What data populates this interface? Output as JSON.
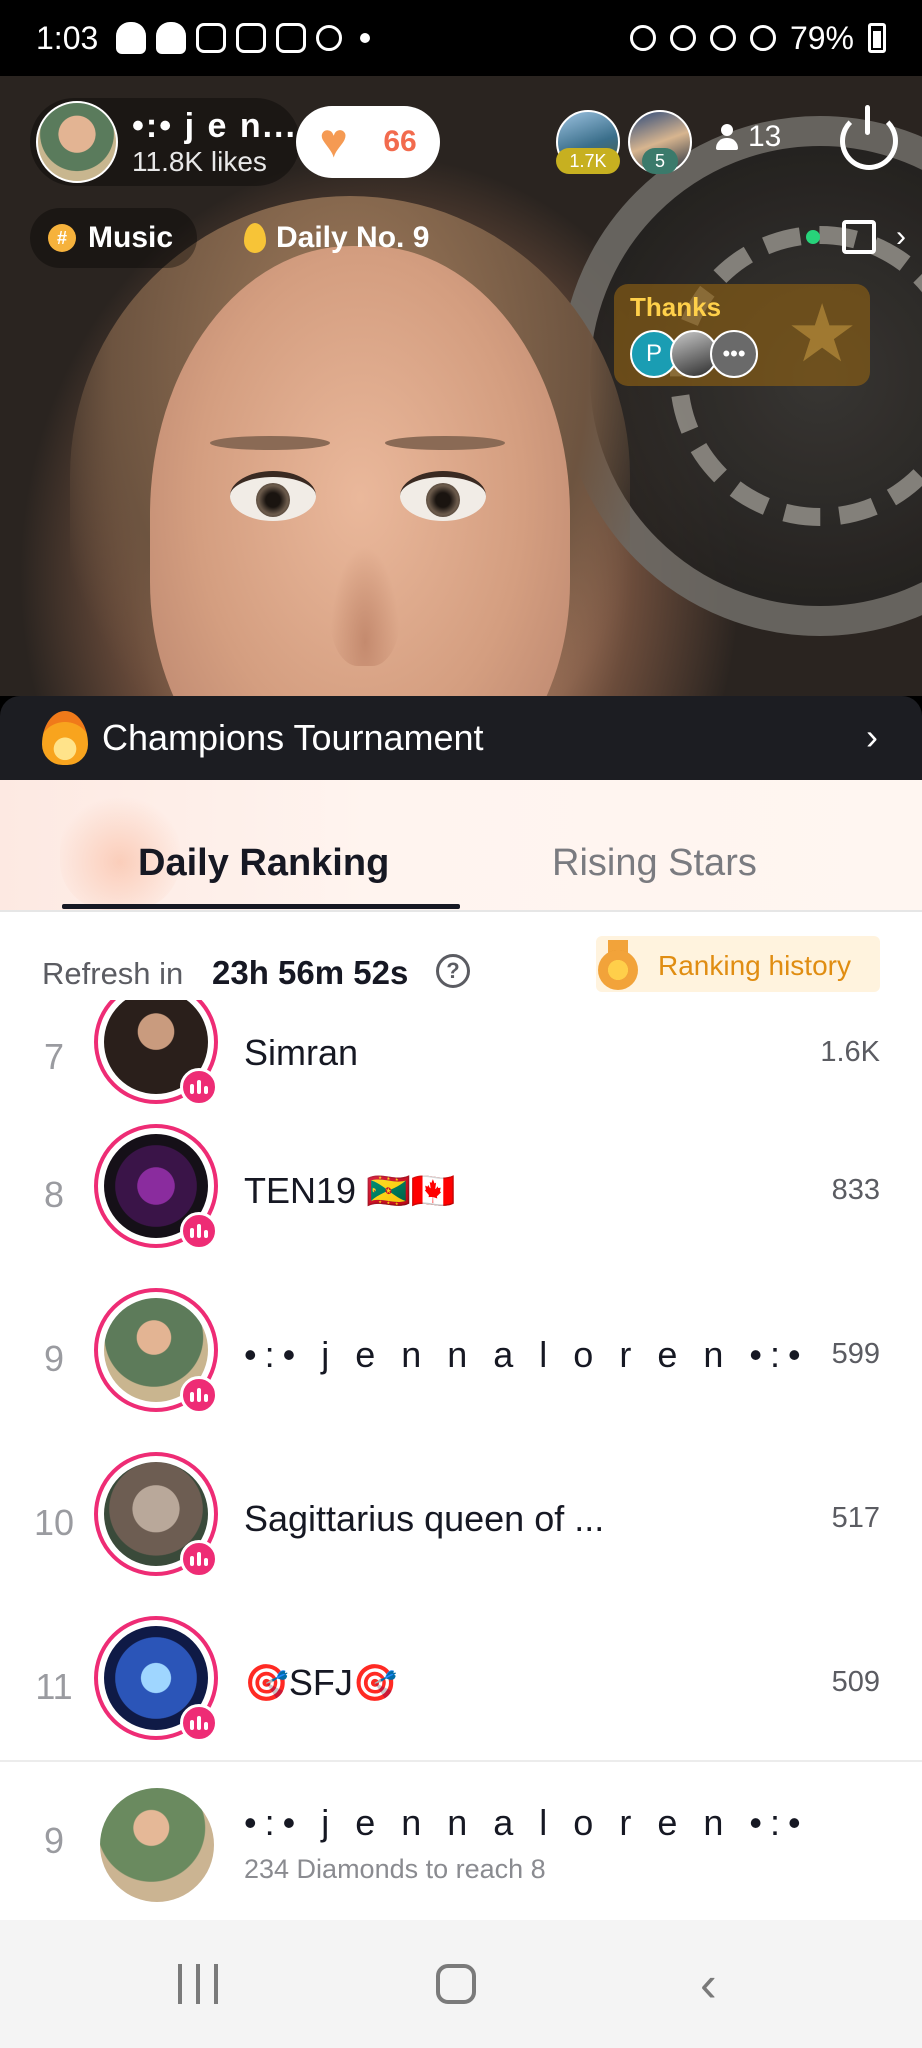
{
  "status_bar": {
    "time": "1:03",
    "battery": "79%"
  },
  "host": {
    "name": "•:• j e n...",
    "likes": "11.8K likes",
    "like_count": "66"
  },
  "viewers": {
    "badge_1": "1.7K",
    "badge_2": "5",
    "count": "13"
  },
  "tags": {
    "music": "Music",
    "daily": "Daily No. 9"
  },
  "thanks": {
    "label": "Thanks",
    "avatar_letter": "P",
    "more": "•••"
  },
  "champions": {
    "title": "Champions Tournament"
  },
  "tabs": {
    "daily": "Daily Ranking",
    "rising": "Rising Stars"
  },
  "refresh": {
    "label": "Refresh in",
    "time": "23h 56m 52s",
    "history": "Ranking history"
  },
  "ranking": [
    {
      "rank": "7",
      "name": "Simran",
      "score": "1.6K"
    },
    {
      "rank": "8",
      "name": "TEN19 🇬🇩🇨🇦",
      "score": "833"
    },
    {
      "rank": "9",
      "name": "•:• j e n n a  l o r e n •:•",
      "score": "599"
    },
    {
      "rank": "10",
      "name": "Sagittarius queen of ...",
      "score": "517"
    },
    {
      "rank": "11",
      "name": "🎯SFJ🎯",
      "score": "509"
    }
  ],
  "me": {
    "rank": "9",
    "name": "•:• j e n n a  l o r e n •:•",
    "subtitle": "234 Diamonds to reach 8"
  },
  "colors": {
    "accent_pink": "#ee2c75",
    "history_orange": "#e08d12",
    "like_orange": "#f26b4e"
  }
}
